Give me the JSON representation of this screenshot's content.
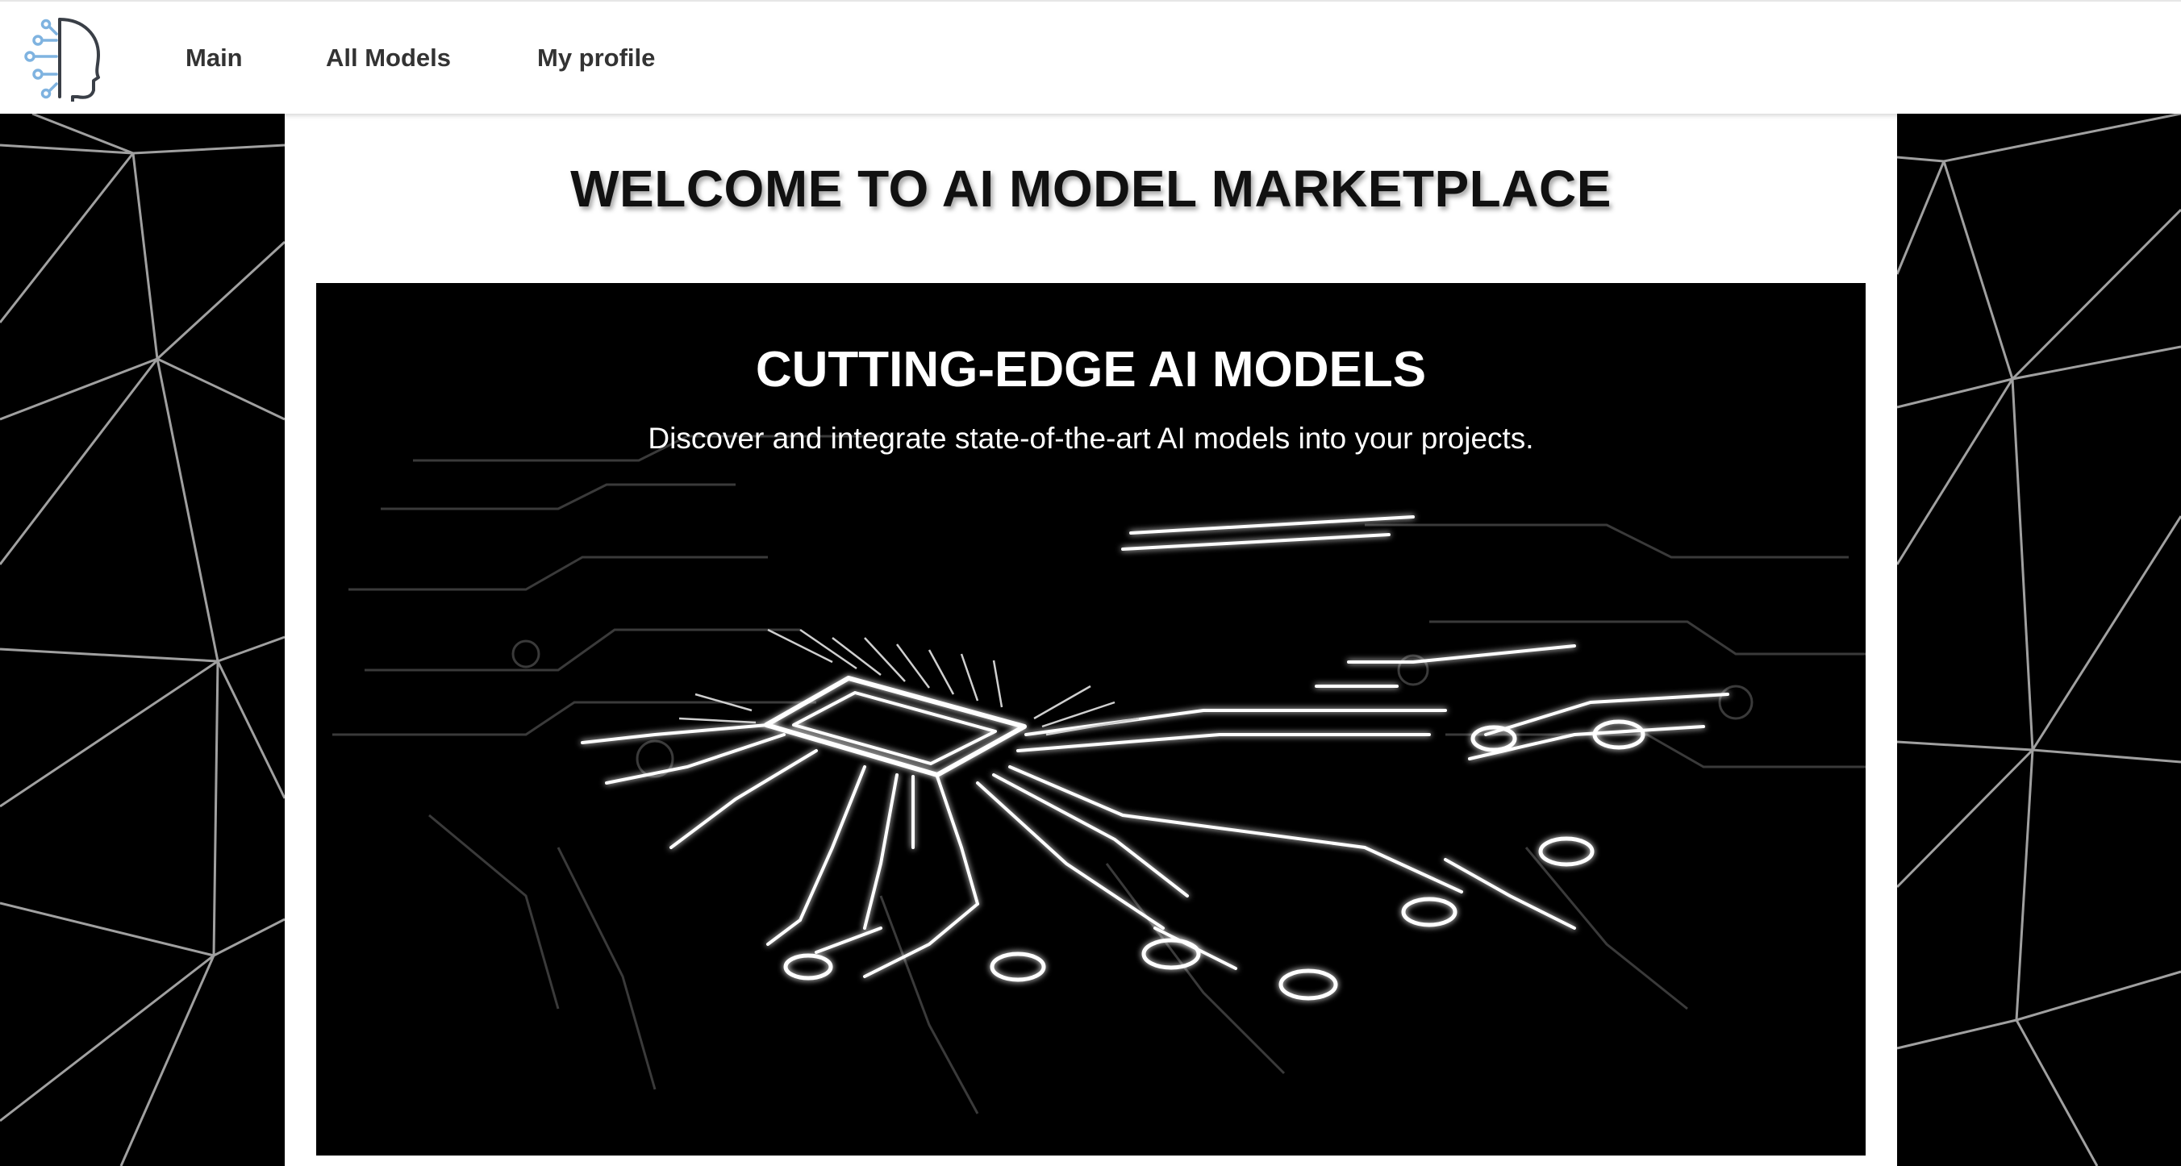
{
  "nav": {
    "logo_icon": "ai-head-circuit-icon",
    "links": [
      {
        "label": "Main"
      },
      {
        "label": "All Models"
      },
      {
        "label": "My profile"
      }
    ]
  },
  "page": {
    "title": "WELCOME TO AI MODEL MARKETPLACE"
  },
  "hero": {
    "heading": "CUTTING-EDGE AI MODELS",
    "subheading": "Discover and integrate state-of-the-art AI models into your projects.",
    "image_icon": "circuit-chip-illustration"
  },
  "colors": {
    "accent": "#7fb3e0",
    "text_dark": "#333333",
    "background": "#000000"
  }
}
